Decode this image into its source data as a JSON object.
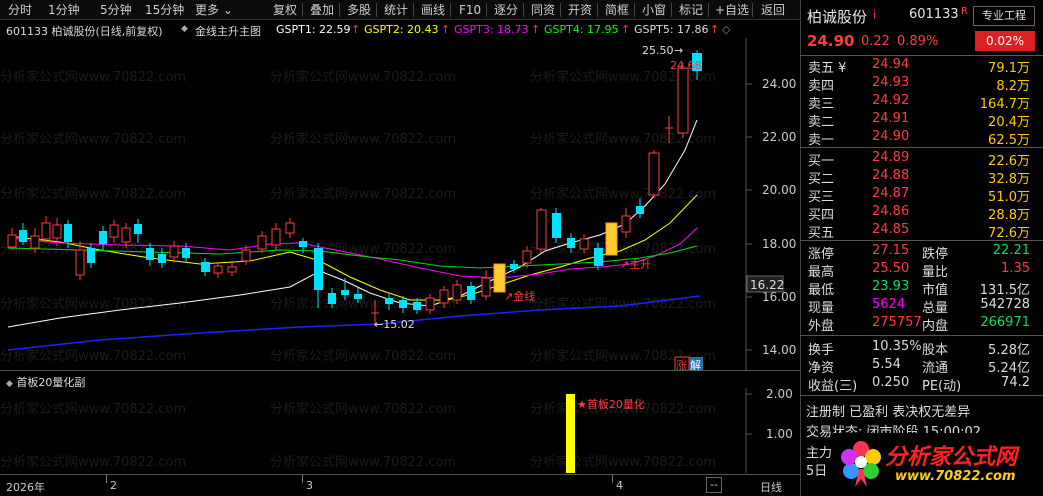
{
  "toolbar": {
    "left_items": [
      "分时",
      "1分钟",
      "5分钟",
      "15分钟",
      "更多"
    ],
    "right_items": [
      "复权",
      "叠加",
      "多股",
      "统计",
      "画线",
      "F10",
      "逐分",
      "同资",
      "开资",
      "简框",
      "小窗",
      "标记",
      "+自选",
      "返回"
    ]
  },
  "info": {
    "stock": "601133 柏诚股份(日线,前复权)",
    "indicator": "金线主升主图",
    "gspt1": "GSPT1: 22.59",
    "gspt2": "GSPT2: 20.43",
    "gspt3": "GSPT3: 18.73",
    "gspt4": "GSPT4: 17.95",
    "gspt5": "GSPT5: 17.86"
  },
  "colors": {
    "up": "#ff3c3c",
    "down": "#00e0ff",
    "gspt1": "#ffffff",
    "gspt2": "#ffff00",
    "gspt3": "#ff00ff",
    "gspt4": "#00ff00",
    "gspt5": "#0000ff"
  },
  "chart_annotations": {
    "high_label": "25.50",
    "price_tag": "24.68",
    "low_label": "15.02",
    "signal_jinxian": "金线",
    "signal_zhusheng": "主升",
    "zhang": "涨",
    "jie": "解",
    "current_price_tag": "16.22",
    "watermark": "分析家公式网www.70822.com"
  },
  "y_axis": [
    "24.00",
    "22.00",
    "20.00",
    "18.00",
    "16.00",
    "14.00"
  ],
  "sub_panel": {
    "title": "首板20量化副",
    "signal_label": "★首板20量化",
    "y_axis": [
      "2.00",
      "1.00"
    ]
  },
  "x_axis": {
    "labels": [
      "2026年",
      "2",
      "3",
      "4"
    ],
    "period": "日线",
    "nav": "--"
  },
  "quote": {
    "name": "柏诚股份",
    "code": "601133",
    "r_badge": "R",
    "pro_button": "专业工程",
    "price": "24.90",
    "change": "0.22",
    "change_pct": "0.89%",
    "box_pct": "0.02%"
  },
  "order_book": {
    "asks": [
      {
        "label": "卖五 ¥",
        "price": "24.94",
        "vol": "79.1万"
      },
      {
        "label": "卖四",
        "price": "24.93",
        "vol": "8.2万"
      },
      {
        "label": "卖三",
        "price": "24.92",
        "vol": "164.7万"
      },
      {
        "label": "卖二",
        "price": "24.91",
        "vol": "20.4万"
      },
      {
        "label": "卖一",
        "price": "24.90",
        "vol": "62.5万"
      }
    ],
    "bids": [
      {
        "label": "买一",
        "price": "24.89",
        "vol": "22.6万"
      },
      {
        "label": "买二",
        "price": "24.88",
        "vol": "32.8万"
      },
      {
        "label": "买三",
        "price": "24.87",
        "vol": "51.0万"
      },
      {
        "label": "买四",
        "price": "24.86",
        "vol": "28.8万"
      },
      {
        "label": "买五",
        "price": "24.85",
        "vol": "72.6万"
      }
    ]
  },
  "stats": [
    {
      "l1": "涨停",
      "v1": "27.15",
      "l2": "跌停",
      "v2": "22.21"
    },
    {
      "l1": "最高",
      "v1": "25.50",
      "l2": "量比",
      "v2": "1.35"
    },
    {
      "l1": "最低",
      "v1": "23.93",
      "l2": "市值",
      "v2": "131.5亿"
    },
    {
      "l1": "现量",
      "v1": "5624",
      "l2": "总量",
      "v2": "542728"
    },
    {
      "l1": "外盘",
      "v1": "275757",
      "l2": "内盘",
      "v2": "266971"
    }
  ],
  "stats2": [
    {
      "l1": "换手",
      "v1": "10.35%",
      "l2": "股本",
      "v2": "5.28亿"
    },
    {
      "l1": "净资",
      "v1": "5.54",
      "l2": "流通",
      "v2": "5.24亿"
    },
    {
      "l1": "收益(三)",
      "v1": "0.250",
      "l2": "PE(动)",
      "v2": "74.2"
    }
  ],
  "footer": {
    "reg": "注册制 已盈利 表决权无差异",
    "status": "交易状态: 闭市阶段 15:00:02",
    "main": "主力",
    "day5": "5日"
  },
  "logo": {
    "title": "分析家公式网",
    "url": "www.70822.com"
  }
}
